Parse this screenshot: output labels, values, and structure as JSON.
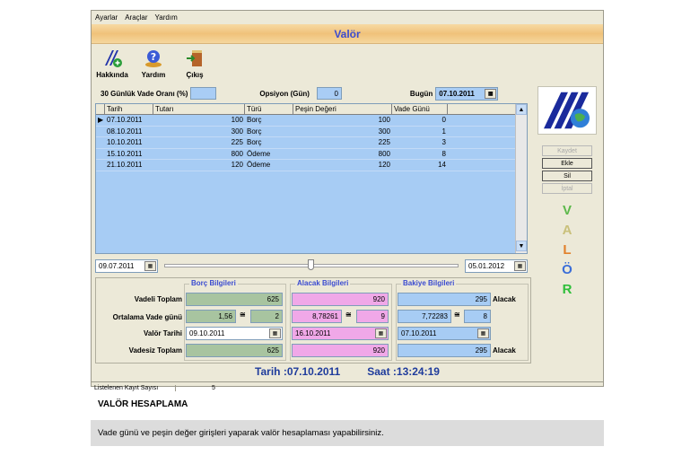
{
  "menu": [
    "Ayarlar",
    "Araçlar",
    "Yardım"
  ],
  "window_title": "Valör",
  "toolbar": [
    {
      "label": "Hakkında",
      "icon": "about-icon"
    },
    {
      "label": "Yardım",
      "icon": "help-icon"
    },
    {
      "label": "Çıkış",
      "icon": "exit-icon"
    }
  ],
  "params": {
    "vade_label": "30 Günlük Vade Oranı (%)",
    "vade_value": "",
    "opsiyon_label": "Opsiyon (Gün)",
    "opsiyon_value": "0",
    "bugun_label": "Bugün",
    "bugun_value": "07.10.2011"
  },
  "grid": {
    "columns": [
      "Tarih",
      "Tutarı",
      "Türü",
      "Peşin Değeri",
      "Vade Günü"
    ],
    "rows": [
      [
        "07.10.2011",
        "100",
        "Borç",
        "100",
        "0"
      ],
      [
        "08.10.2011",
        "300",
        "Borç",
        "300",
        "1"
      ],
      [
        "10.10.2011",
        "225",
        "Borç",
        "225",
        "3"
      ],
      [
        "15.10.2011",
        "800",
        "Ödeme",
        "800",
        "8"
      ],
      [
        "21.10.2011",
        "120",
        "Ödeme",
        "120",
        "14"
      ]
    ]
  },
  "filter": {
    "from": "09.07.2011",
    "to": "05.01.2012",
    "slider_position": 0.5
  },
  "summary": {
    "groups": [
      "Borç Bilgileri",
      "Alacak Bilgileri",
      "Bakiye Bilgileri"
    ],
    "row_labels": [
      "Vadeli Toplam",
      "Ortalama Vade günü",
      "Valör Tarihi",
      "Vadesiz Toplam"
    ],
    "borc": {
      "vadeli": "625",
      "oran": "1,56",
      "gun": "2",
      "tarih": "09.10.2011",
      "vadesiz": "625"
    },
    "alacak": {
      "vadeli": "920",
      "oran": "8,78261",
      "gun": "9",
      "tarih": "16.10.2011",
      "vadesiz": "920"
    },
    "bakiye": {
      "vadeli": "295",
      "vadeli_suffix": "Alacak",
      "oran": "7,72283",
      "gun": "8",
      "tarih": "07.10.2011",
      "vadesiz": "295",
      "vadesiz_suffix": "Alacak"
    },
    "approx": "≅"
  },
  "side": {
    "buttons": [
      "Kaydet",
      "Ekle",
      "Sil",
      "İptal"
    ],
    "letters": [
      "V",
      "A",
      "L",
      "Ö",
      "R"
    ],
    "letter_colors": [
      "#5cb84a",
      "#c9c07a",
      "#e2812c",
      "#3b6ed8",
      "#2fbf3a"
    ]
  },
  "datetime": {
    "tarih": "Tarih :07.10.2011",
    "saat": "Saat :13:24:19"
  },
  "status": {
    "label": "Listelenen Kayıt Sayısı",
    "value": "5"
  },
  "caption": {
    "heading": "VALÖR HESAPLAMA",
    "description": "Vade günü ve peşin değer girişleri yaparak valör hesaplaması yapabilirsiniz."
  }
}
